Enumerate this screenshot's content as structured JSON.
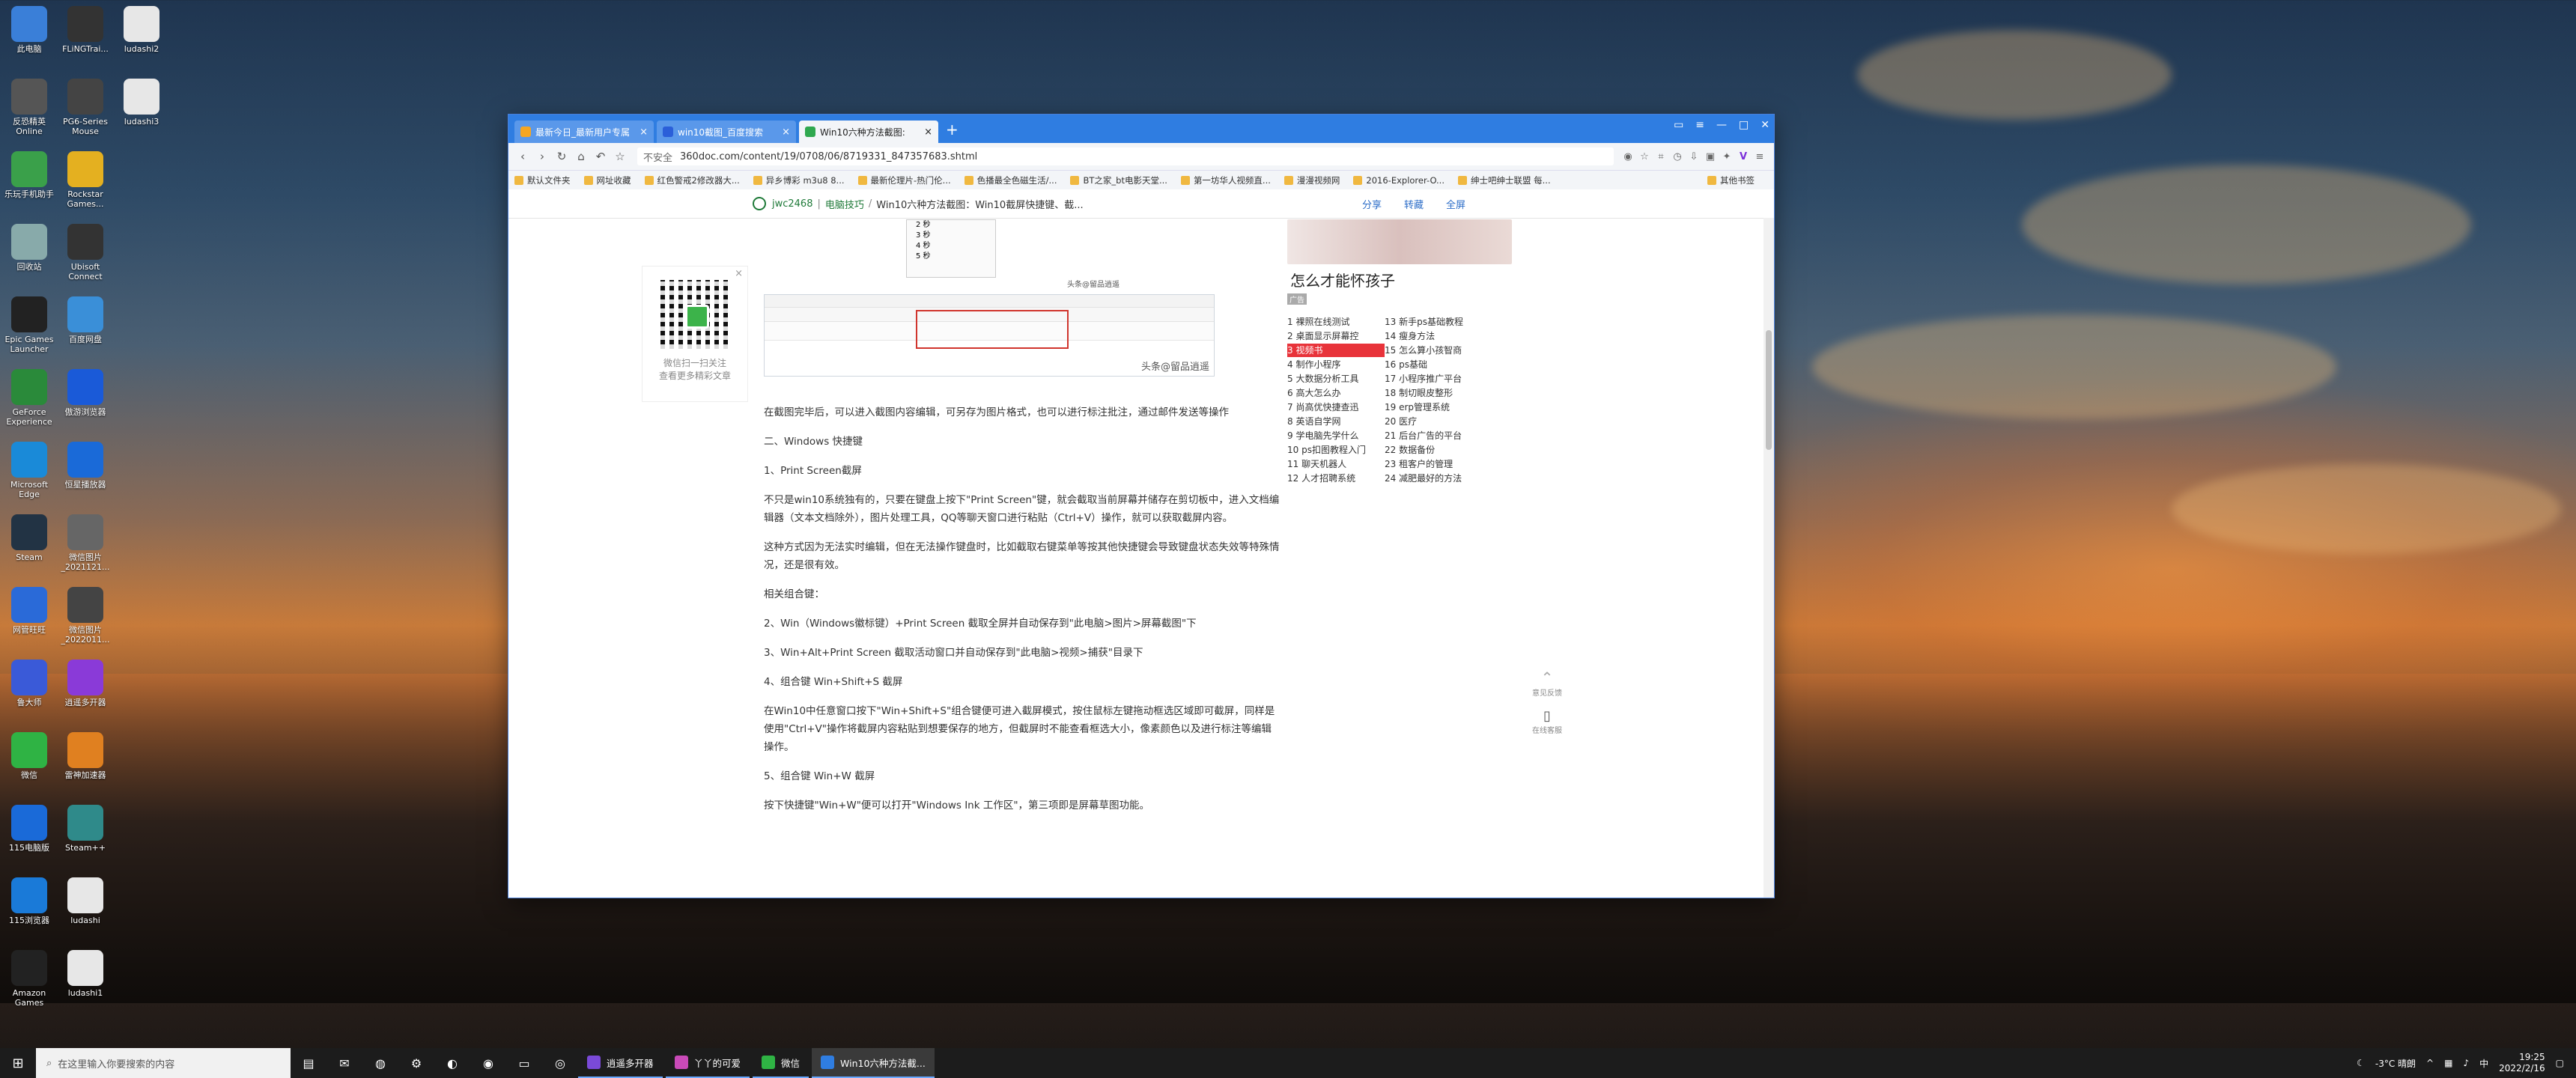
{
  "desktop": {
    "icons": [
      {
        "label": "此电脑"
      },
      {
        "label": "FLiNGTrai..."
      },
      {
        "label": "ludashi2"
      },
      {
        "label": "反恐精英 Online"
      },
      {
        "label": "PG6-Series Mouse"
      },
      {
        "label": "ludashi3"
      },
      {
        "label": "乐玩手机助手"
      },
      {
        "label": "Rockstar Games..."
      },
      {
        "label": "回收站"
      },
      {
        "label": "Ubisoft Connect"
      },
      {
        "label": "Epic Games Launcher"
      },
      {
        "label": "百度网盘"
      },
      {
        "label": "GeForce Experience"
      },
      {
        "label": "傲游浏览器"
      },
      {
        "label": "Microsoft Edge"
      },
      {
        "label": "恒星播放器"
      },
      {
        "label": "Steam"
      },
      {
        "label": "微信图片_2021121..."
      },
      {
        "label": "网管旺旺"
      },
      {
        "label": "微信图片_2022011..."
      },
      {
        "label": "鲁大师"
      },
      {
        "label": "逍遥多开器"
      },
      {
        "label": "微信"
      },
      {
        "label": "雷神加速器"
      },
      {
        "label": "115电脑版"
      },
      {
        "label": "Steam++"
      },
      {
        "label": "115浏览器"
      },
      {
        "label": "ludashi"
      },
      {
        "label": "Amazon Games"
      },
      {
        "label": "ludashi1"
      }
    ]
  },
  "browser": {
    "tabs": [
      {
        "label": "最新今日_最新用户专属"
      },
      {
        "label": "win10截图_百度搜索"
      },
      {
        "label": "Win10六种方法截图:"
      }
    ],
    "new_tab": "+",
    "address": {
      "security": "不安全",
      "url": "360doc.com/content/19/0708/06/8719331_847357683.shtml"
    },
    "bookmarks": [
      "默认文件夹",
      "网址收藏",
      "红色警戒2修改器大...",
      "异乡博彩 m3u8 8...",
      "最新伦理片-热门伦...",
      "色播最全色磁生活/...",
      "BT之家_bt电影天堂...",
      "第一坊华人视频直...",
      "漫漫视频网",
      "2016-Explorer-O...",
      "绅士吧绅士联盟 每..."
    ],
    "other_bookmarks": "其他书签",
    "page": {
      "crumb": {
        "author": "jwc2468",
        "category": "电脑技巧",
        "title": "Win10六种方法截图：Win10截屏快捷键、截..."
      },
      "actions": {
        "share": "分享",
        "repost": "转藏",
        "fullscreen": "全屏"
      },
      "qr": {
        "line1": "微信扫一扫关注",
        "line2": "查看更多精彩文章"
      },
      "image_caption": "头条@留品逍遥",
      "image_caption2": "头条@留品逍遥",
      "seconds": [
        "2 秒",
        "3 秒",
        "4 秒",
        "5 秒"
      ],
      "paragraphs": [
        "在截图完毕后，可以进入截图内容编辑，可另存为图片格式，也可以进行标注批注，通过邮件发送等操作",
        "二、Windows 快捷键",
        "1、Print Screen截屏",
        "不只是win10系统独有的，只要在键盘上按下\"Print Screen\"键，就会截取当前屏幕并储存在剪切板中，进入文档编辑器（文本文档除外），图片处理工具，QQ等聊天窗口进行粘贴（Ctrl+V）操作，就可以获取截屏内容。",
        "这种方式因为无法实时编辑，但在无法操作键盘时，比如截取右键菜单等按其他快捷键会导致键盘状态失效等特殊情况，还是很有效。",
        "相关组合键：",
        "2、Win（Windows徽标键）+Print Screen 截取全屏并自动保存到\"此电脑>图片>屏幕截图\"下",
        "3、Win+Alt+Print Screen 截取活动窗口并自动保存到\"此电脑>视频>捕获\"目录下",
        "4、组合键 Win+Shift+S 截屏",
        "在Win10中任意窗口按下\"Win+Shift+S\"组合键便可进入截屏模式，按住鼠标左键拖动框选区域即可截屏，同样是使用\"Ctrl+V\"操作将截屏内容粘贴到想要保存的地方，但截屏时不能查看框选大小，像素颜色以及进行标注等编辑操作。",
        "5、组合键 Win+W 截屏",
        "按下快捷键\"Win+W\"便可以打开\"Windows Ink 工作区\"，第三项即是屏幕草图功能。"
      ],
      "sidebar": {
        "title": "怎么才能怀孩子",
        "ad_tag": "广告",
        "hot": [
          "1 裸照在线测试",
          "13 新手ps基础教程",
          "2 桌面显示屏幕控",
          "14 瘦身方法",
          "3 视频书",
          "15 怎么算小孩智商",
          "4 制作小程序",
          "16 ps基础",
          "5 大数据分析工具",
          "17 小程序推广平台",
          "6 高大怎么办",
          "18 制切眼皮整形",
          "7 尚高优快捷查迅",
          "19 erp管理系统",
          "8 英语自学网",
          "20 医疗",
          "9 学电脑先学什么",
          "21 后台广告的平台",
          "10 ps扣图教程入门",
          "22 数据备份",
          "11 聊天机器人",
          "23 租客户的管理",
          "12 人才招聘系统",
          "24 减肥最好的方法"
        ]
      },
      "float": {
        "top": "意见反馈",
        "mobile": "在线客服"
      }
    }
  },
  "taskbar": {
    "search_placeholder": "在这里输入你要搜索的内容",
    "apps": [
      {
        "label": "逍遥多开器",
        "color": "#7a4ad8"
      },
      {
        "label": "丫丫的可爱",
        "color": "#c94ab8"
      },
      {
        "label": "微信",
        "color": "#2fb344"
      },
      {
        "label": "Win10六种方法截...",
        "color": "#2f7de1"
      }
    ],
    "weather": "-3°C 晴朗",
    "time": "19:25",
    "date": "2022/2/16"
  }
}
